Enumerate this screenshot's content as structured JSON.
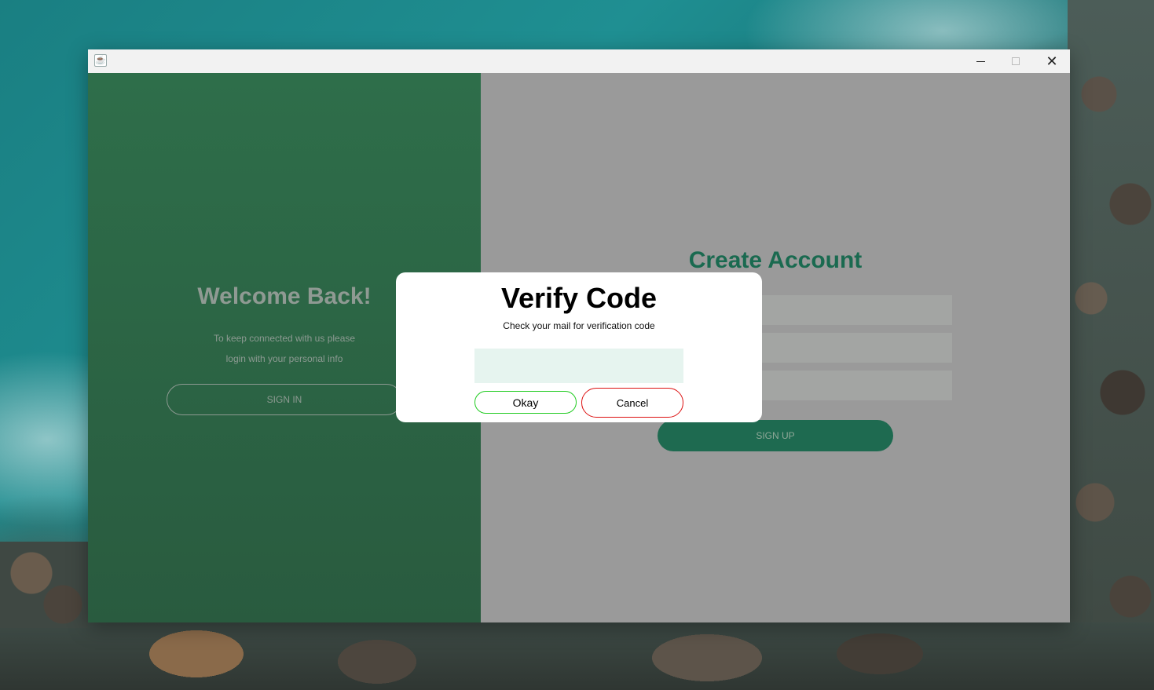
{
  "window": {
    "title": "",
    "icon": "java-cup-icon",
    "controls": {
      "minimize_icon": "minimize-icon",
      "maximize_icon": "maximize-icon",
      "close_glyph": "✕"
    }
  },
  "left_panel": {
    "title": "Welcome Back!",
    "line1": "To keep connected with us please",
    "line2": "login with your personal info",
    "signin_label": "SIGN IN",
    "color": "#2e6e4a"
  },
  "right_panel": {
    "title": "Create Account",
    "signup_label": "SIGN UP",
    "accent": "#1e6a50"
  },
  "dialog": {
    "title": "Verify Code",
    "subtitle": "Check your mail for verification code",
    "code_value": "",
    "okay_label": "Okay",
    "cancel_label": "Cancel",
    "okay_border": "#22cc22",
    "cancel_border": "#dd1111"
  }
}
